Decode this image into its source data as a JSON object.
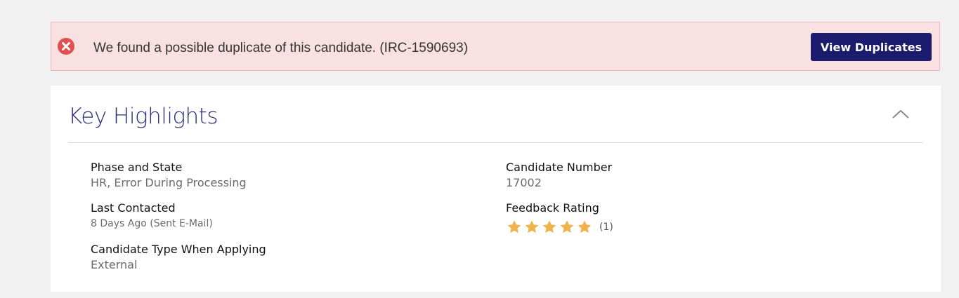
{
  "alert": {
    "message": "We found a possible duplicate of this candidate. (IRC-1590693)",
    "button_label": "View Duplicates",
    "icon": "error-circle-icon"
  },
  "card": {
    "title": "Key Highlights",
    "collapse_icon": "chevron-up-icon",
    "fields": {
      "phase_state": {
        "label": "Phase and State",
        "value": "HR, Error During Processing"
      },
      "last_contacted": {
        "label": "Last Contacted",
        "value": "8 Days Ago (Sent E-Mail)"
      },
      "candidate_type": {
        "label": "Candidate Type When Applying",
        "value": "External"
      },
      "candidate_number": {
        "label": "Candidate Number",
        "value": "17002"
      },
      "feedback_rating": {
        "label": "Feedback Rating",
        "stars": 5,
        "max_stars": 5,
        "count": "(1)"
      }
    }
  },
  "colors": {
    "alert_bg": "#f9e1e1",
    "alert_icon": "#e25050",
    "button_bg": "#1b1c6d",
    "title": "#2b2f74",
    "star": "#f0b24a"
  }
}
